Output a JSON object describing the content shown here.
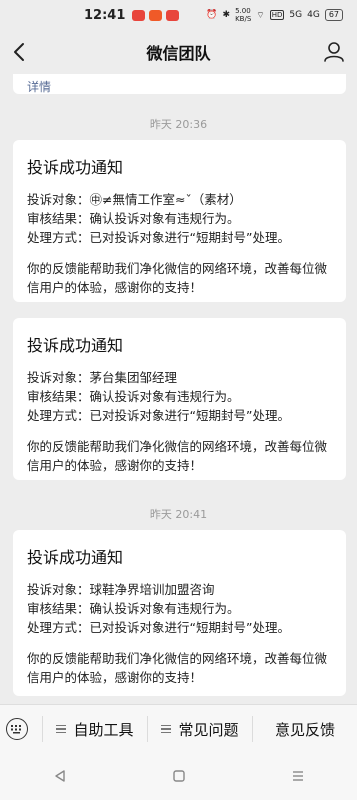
{
  "status_bar": {
    "time": "12:41",
    "speed": "5.00\nKB/S",
    "hd": "HD",
    "sig1": "5G",
    "sig2": "4G",
    "battery": "67"
  },
  "header": {
    "title": "微信团队"
  },
  "partial_message": {
    "link": "详情"
  },
  "timestamps": [
    "昨天 20:36",
    "昨天 20:41"
  ],
  "messages": [
    {
      "title": "投诉成功通知",
      "target": "投诉对象：㊥≠無情工作室≈ˇ（素材）",
      "result": "审核结果：确认投诉对象有违规行为。",
      "action": "处理方式：已对投诉对象进行“短期封号”处理。",
      "note": "你的反馈能帮助我们净化微信的网络环境，改善每位微信用户的体验，感谢你的支持！"
    },
    {
      "title": "投诉成功通知",
      "target": "投诉对象：茅台集团邹经理",
      "result": "审核结果：确认投诉对象有违规行为。",
      "action": "处理方式：已对投诉对象进行“短期封号”处理。",
      "note": "你的反馈能帮助我们净化微信的网络环境，改善每位微信用户的体验，感谢你的支持！"
    },
    {
      "title": "投诉成功通知",
      "target": "投诉对象：球鞋净界培训加盟咨询",
      "result": "审核结果：确认投诉对象有违规行为。",
      "action": "处理方式：已对投诉对象进行“短期封号”处理。",
      "note": "你的反馈能帮助我们净化微信的网络环境，改善每位微信用户的体验，感谢你的支持！"
    }
  ],
  "bottom_menu": {
    "items": [
      "自助工具",
      "常见问题",
      "意见反馈"
    ]
  },
  "colors": {
    "background": "#ededed",
    "card": "#ffffff",
    "link": "#576b95",
    "badge1": "#e8453c",
    "badge2": "#f05a28",
    "badge3": "#e8453c"
  }
}
